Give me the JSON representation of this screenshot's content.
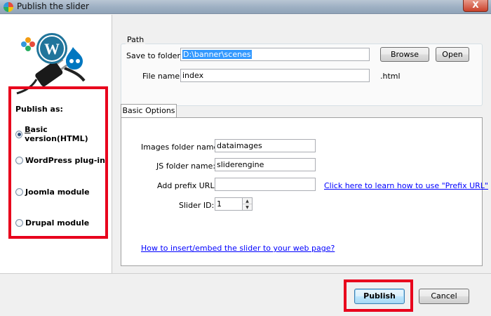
{
  "window": {
    "title": "Publish the slider",
    "close_label": "X"
  },
  "colors": {
    "highlight": "#e8001c",
    "link": "#0000ff",
    "selection": "#3399ff"
  },
  "publish_as": {
    "label": "Publish as:",
    "selected": "basic",
    "options": [
      {
        "id": "basic",
        "label": "Basic version(HTML)",
        "checked": true
      },
      {
        "id": "wordpress",
        "label": "WordPress plug-in",
        "checked": false
      },
      {
        "id": "joomla",
        "label": "Joomla module",
        "checked": false
      },
      {
        "id": "drupal",
        "label": "Drupal module",
        "checked": false
      }
    ]
  },
  "path": {
    "group_label": "Path",
    "save_to_label": "Save to folder:",
    "save_to_value": "D:\\banner\\scenes",
    "browse_label": "Browse",
    "open_label": "Open",
    "file_name_label": "File name:",
    "file_name_value": "index",
    "extension": ".html"
  },
  "basic_options": {
    "tab_label": "Basic Options",
    "images_folder_label": "Images folder name:",
    "images_folder_value": "dataimages",
    "js_folder_label": "JS folder name:",
    "js_folder_value": "sliderengine",
    "prefix_url_label": "Add prefix URL:",
    "prefix_url_value": "",
    "prefix_url_help": "Click here to learn how to use \"Prefix URL\"",
    "slider_id_label": "Slider ID:",
    "slider_id_value": "1",
    "embed_help": "How to insert/embed the slider to your web page?"
  },
  "footer": {
    "publish_label": "Publish",
    "cancel_label": "Cancel"
  },
  "icons": {
    "app": "app-logo-icon",
    "logo": "cms-logos-plug-icon"
  }
}
